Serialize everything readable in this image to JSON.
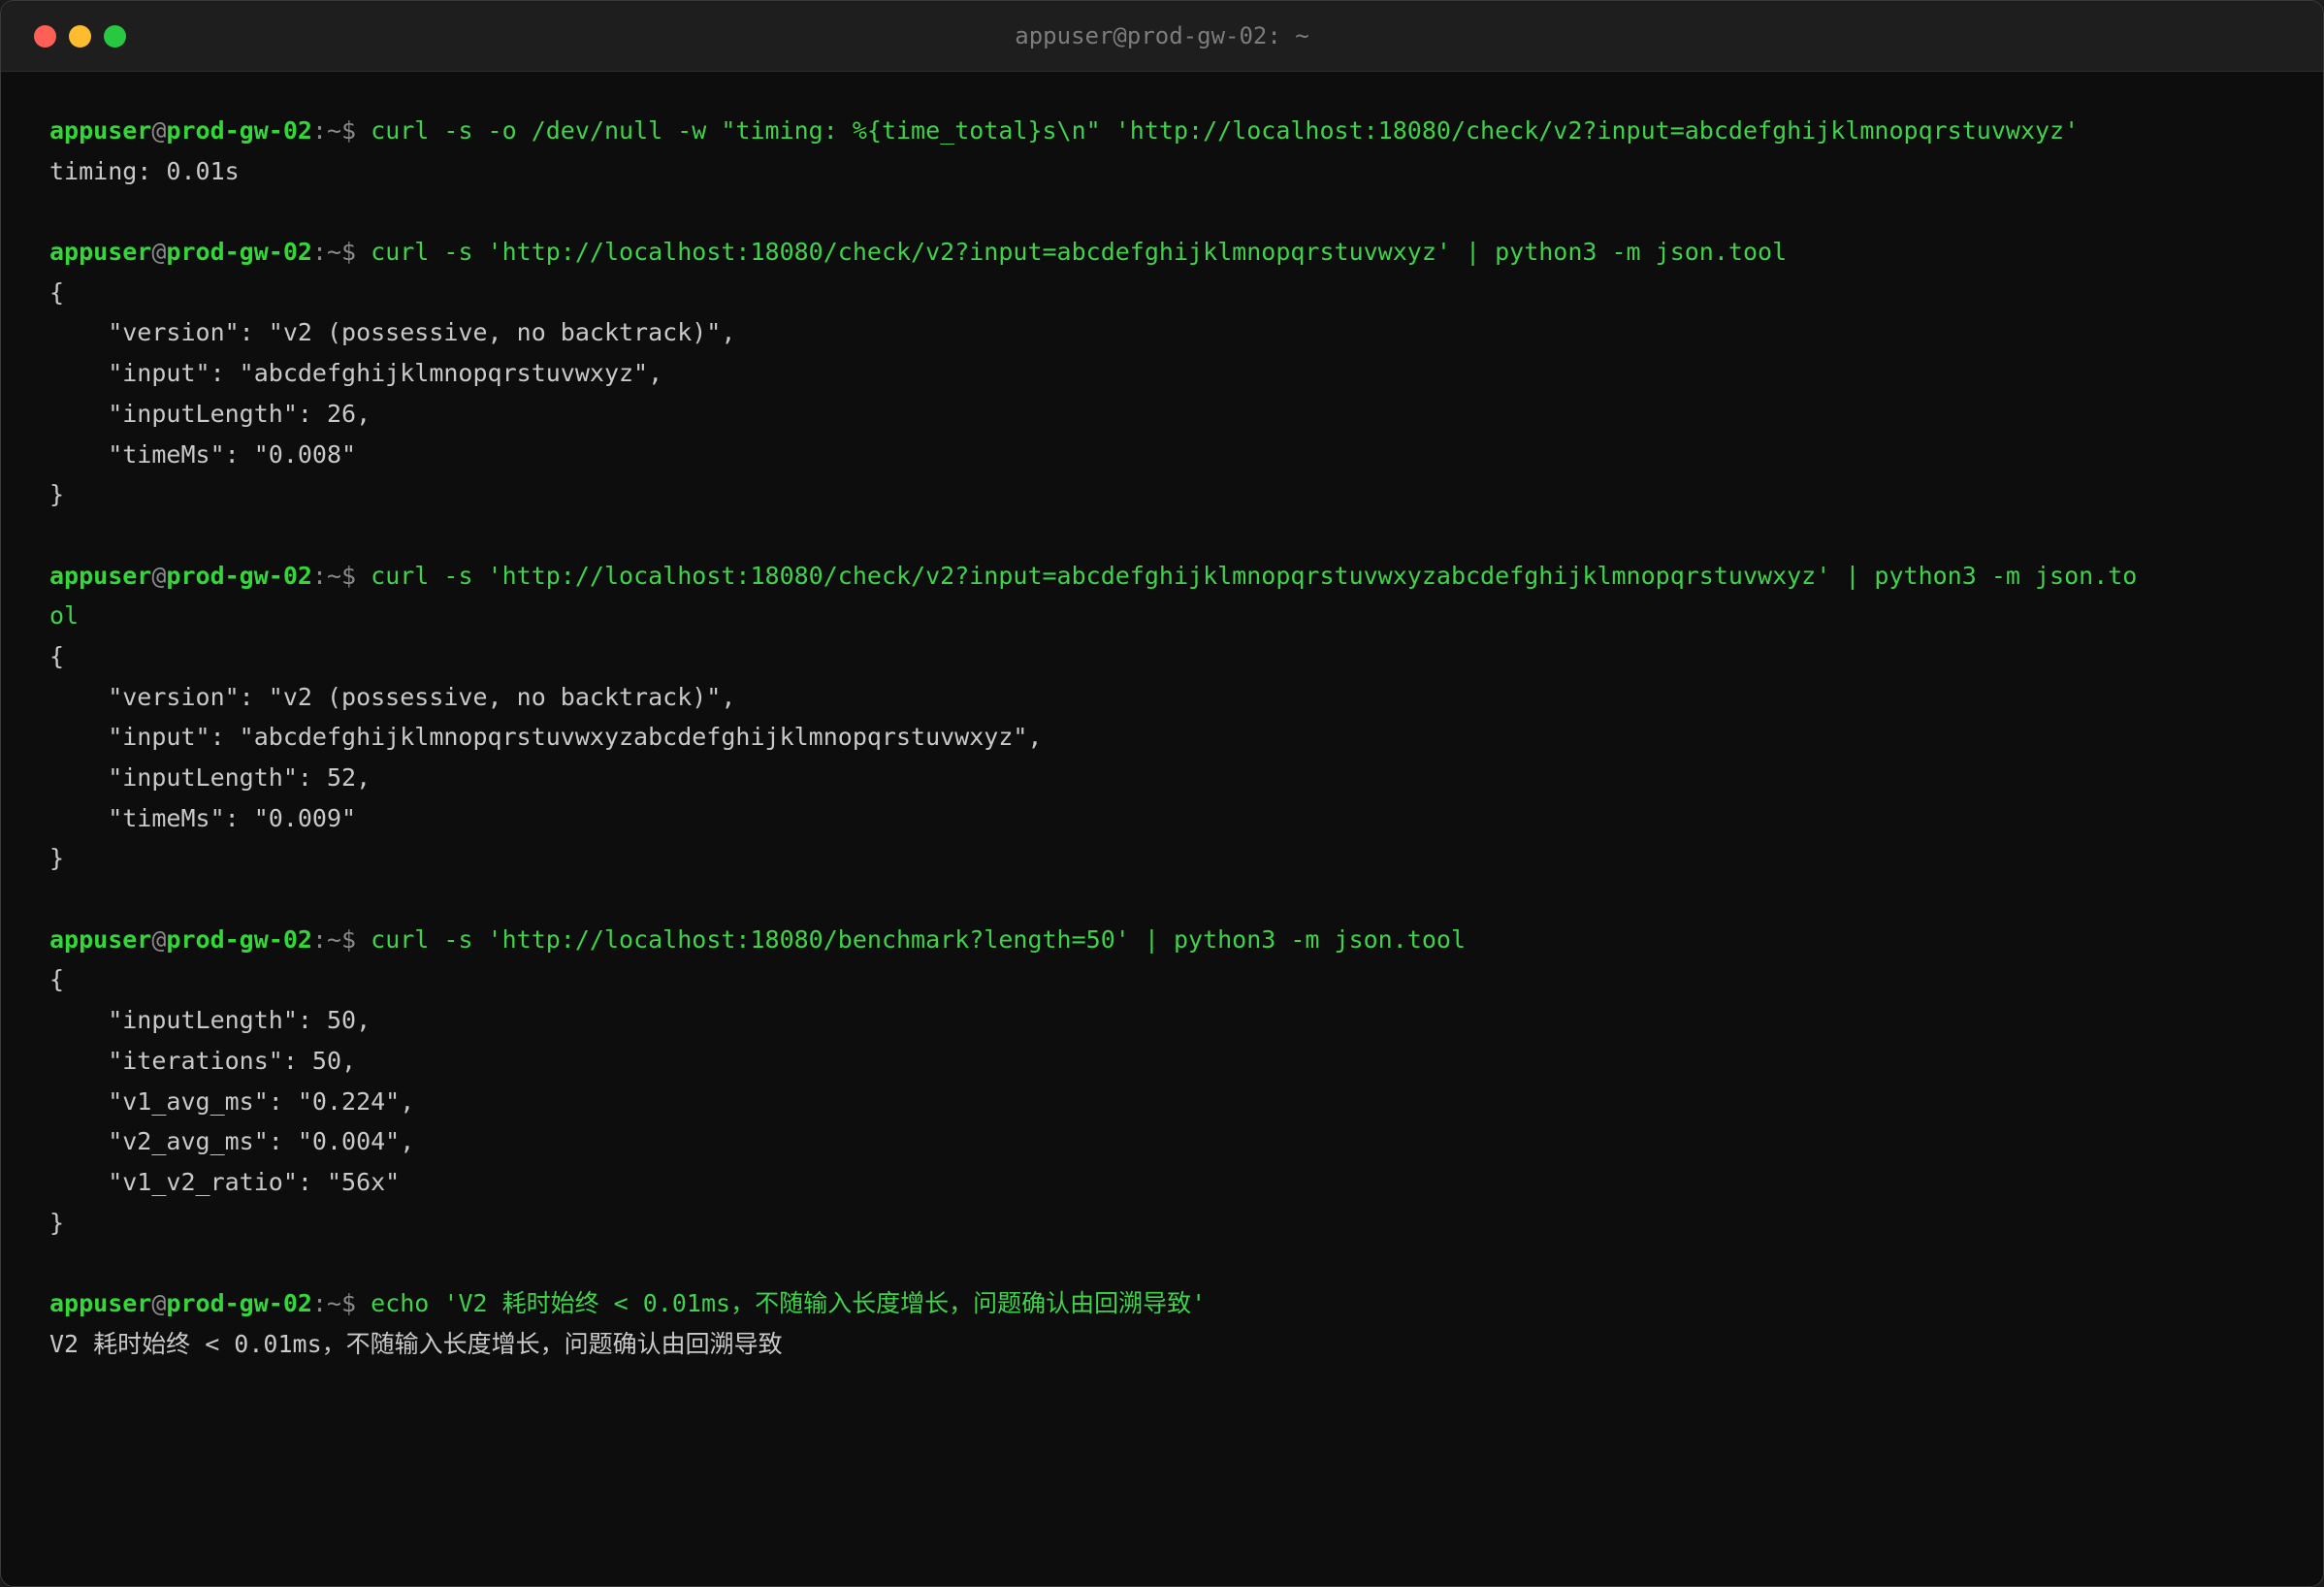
{
  "window": {
    "title": "appuser@prod-gw-02: ~"
  },
  "prompt": {
    "user": "appuser",
    "at": "@",
    "host": "prod-gw-02",
    "path": ":~$"
  },
  "blocks": [
    {
      "command": "curl -s -o /dev/null -w \"timing: %{time_total}s\\n\" 'http://localhost:18080/check/v2?input=abcdefghijklmnopqrstuvwxyz'",
      "output_lines": [
        "timing: 0.01s"
      ]
    },
    {
      "command": "curl -s 'http://localhost:18080/check/v2?input=abcdefghijklmnopqrstuvwxyz' | python3 -m json.tool",
      "output_lines": [
        "{",
        "    \"version\": \"v2 (possessive, no backtrack)\",",
        "    \"input\": \"abcdefghijklmnopqrstuvwxyz\",",
        "    \"inputLength\": 26,",
        "    \"timeMs\": \"0.008\"",
        "}"
      ]
    },
    {
      "command": "curl -s 'http://localhost:18080/check/v2?input=abcdefghijklmnopqrstuvwxyzabcdefghijklmnopqrstuvwxyz' | python3 -m json.to",
      "command_wrap": "ol",
      "output_lines": [
        "{",
        "    \"version\": \"v2 (possessive, no backtrack)\",",
        "    \"input\": \"abcdefghijklmnopqrstuvwxyzabcdefghijklmnopqrstuvwxyz\",",
        "    \"inputLength\": 52,",
        "    \"timeMs\": \"0.009\"",
        "}"
      ]
    },
    {
      "command": "curl -s 'http://localhost:18080/benchmark?length=50' | python3 -m json.tool",
      "output_lines": [
        "{",
        "    \"inputLength\": 50,",
        "    \"iterations\": 50,",
        "    \"v1_avg_ms\": \"0.224\",",
        "    \"v2_avg_ms\": \"0.004\",",
        "    \"v1_v2_ratio\": \"56x\"",
        "}"
      ]
    },
    {
      "command": "echo 'V2 耗时始终 < 0.01ms，不随输入长度增长，问题确认由回溯导致'",
      "output_lines": [
        "V2 耗时始终 < 0.01ms，不随输入长度增长，问题确认由回溯导致"
      ]
    }
  ]
}
